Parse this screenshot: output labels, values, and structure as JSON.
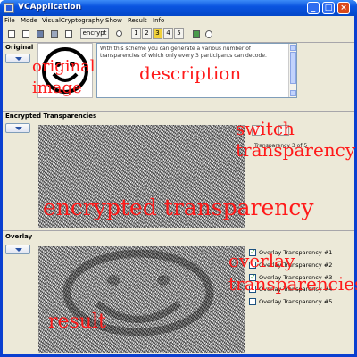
{
  "window": {
    "title": "VCApplication"
  },
  "menu": [
    "File",
    "Mode",
    "VisualCryptography",
    "Show",
    "Result",
    "Info"
  ],
  "toolbar": {
    "icons": [
      "new-icon",
      "open-icon",
      "save-icon",
      "save-as-icon",
      "print-icon"
    ],
    "encrypt_label": "encrypt",
    "key_icon": "key-icon",
    "numbers": [
      "1",
      "2",
      "3",
      "4",
      "5"
    ],
    "active_number": "3",
    "extra_icons": [
      "image-icon",
      "chat-icon"
    ]
  },
  "original": {
    "label": "Original",
    "description": "With this scheme you can generate a various number of transparencies of which only every 3 participants can decode."
  },
  "encrypted": {
    "label": "Encrypted Transparencies",
    "transparency_label": "Transparency 3 of 5"
  },
  "overlay": {
    "label": "Overlay",
    "checkboxes": [
      {
        "label": "Overlay Transparency #1",
        "checked": true
      },
      {
        "label": "Overlay Transparency #2",
        "checked": false
      },
      {
        "label": "Overlay Transparency #3",
        "checked": true
      },
      {
        "label": "Overlay Transparency #4",
        "checked": false
      },
      {
        "label": "Overlay Transparency #5",
        "checked": false
      }
    ]
  },
  "annotations": {
    "original_image_1": "original",
    "original_image_2": "image",
    "description": "description",
    "switch_1": "switch",
    "switch_2": "transparency",
    "encrypted": "encrypted transparency",
    "overlay_1": "overlay",
    "overlay_2": "transparencies",
    "result": "result"
  },
  "colors": {
    "annotation": "#ff1a1a",
    "title_bar": "#0a55e0",
    "active_number": "#f1d13b"
  }
}
